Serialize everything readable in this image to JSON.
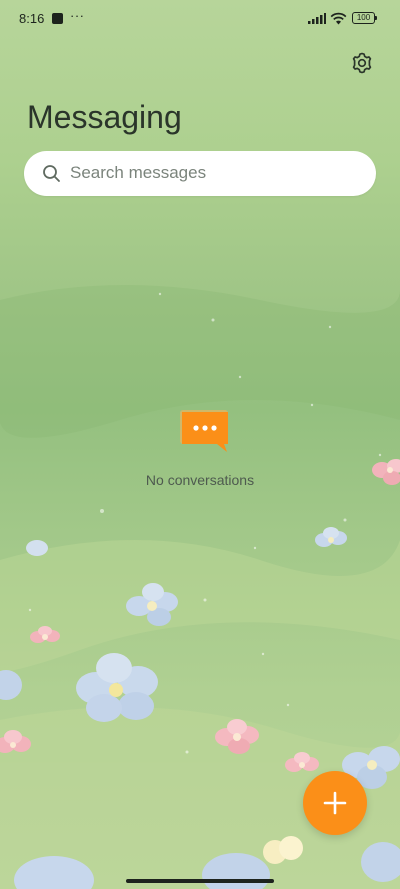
{
  "status_bar": {
    "time": "8:16",
    "more": "···",
    "battery": "100"
  },
  "header": {
    "title": "Messaging",
    "settings_icon": "gear-icon"
  },
  "search": {
    "placeholder": "Search messages",
    "icon": "search-icon"
  },
  "empty_state": {
    "icon": "chat-bubble-icon",
    "text": "No conversations"
  },
  "fab": {
    "icon": "plus-icon"
  },
  "colors": {
    "accent": "#fb8f18",
    "background": "#a6cb8c"
  }
}
